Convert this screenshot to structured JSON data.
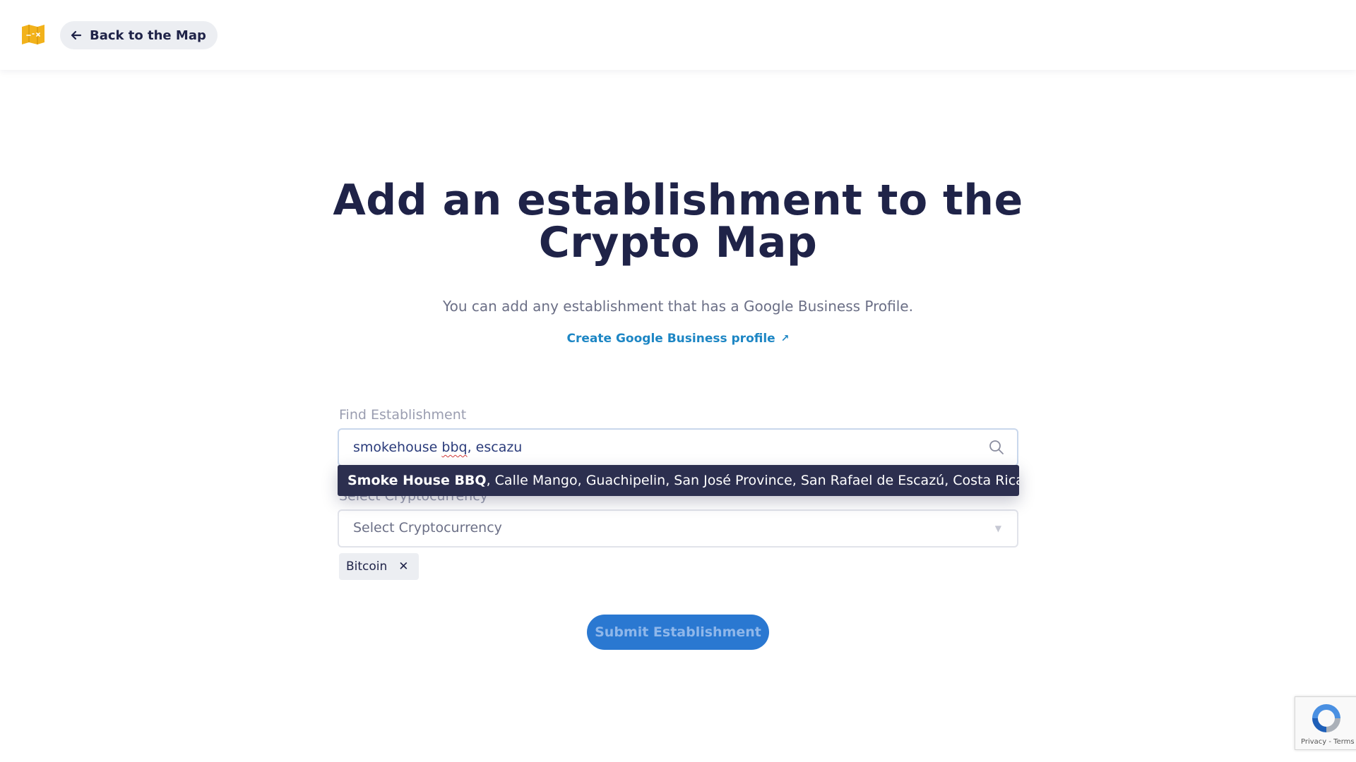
{
  "header": {
    "back_label": "Back to the Map",
    "logo_icon": "crypto-map-logo",
    "back_icon": "arrow-left-icon"
  },
  "main": {
    "title": "Add an establishment to the Crypto Map",
    "subtitle": "You can add any establishment that has a Google Business Profile.",
    "gbp_link": "Create Google Business profile",
    "gbp_link_icon": "↗"
  },
  "form": {
    "find_label": "Find Establishment",
    "search_value_parts": [
      "smokehouse ",
      "bbq",
      ", escazu"
    ],
    "crypto_label": "Select Cryptocurrency",
    "crypto_placeholder": "Select Cryptocurrency",
    "selected_tags": [
      "Bitcoin"
    ],
    "tag_remove_glyph": "✕",
    "submit_label": "Submit Establishment"
  },
  "autocomplete": {
    "suggestion_name": "Smoke House BBQ",
    "suggestion_address": ", Calle Mango, Guachipelin, San José Province, San Rafael de Escazú, Costa Rica"
  },
  "recaptcha": {
    "footer": "Privacy - Terms"
  },
  "colors": {
    "primary_text": "#1f2348",
    "link": "#1d86c4",
    "button": "#2a78d1",
    "suggestion_bg": "#2c2f4f",
    "logo": "#f2b21b"
  }
}
